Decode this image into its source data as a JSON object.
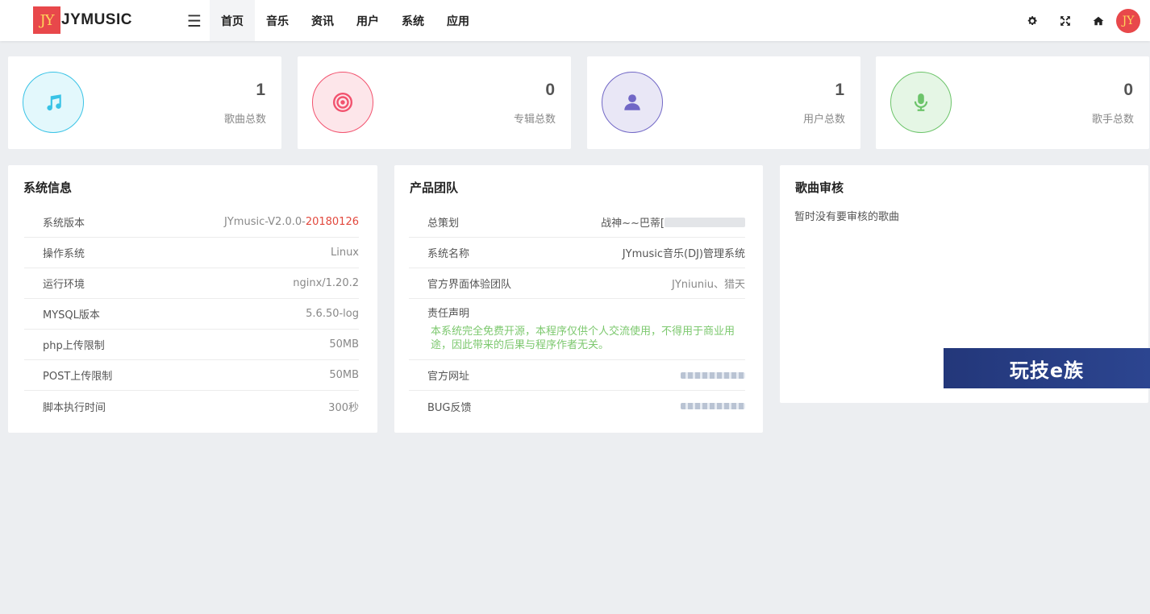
{
  "app": {
    "logo_badge": "JY",
    "name": "JYMUSIC"
  },
  "nav": {
    "menu_icon": "hamburger-icon",
    "items": [
      "首页",
      "音乐",
      "资讯",
      "用户",
      "系统",
      "应用"
    ],
    "active": "首页"
  },
  "tools": {
    "settings_icon": "gear-icon",
    "fullscreen_icon": "expand-icon",
    "home_icon": "home-icon",
    "avatar_text": "JY"
  },
  "stats": [
    {
      "value": "1",
      "label": "歌曲总数",
      "icon": "music-note-icon",
      "color": "#39c3e6"
    },
    {
      "value": "0",
      "label": "专辑总数",
      "icon": "target-icon",
      "color": "#f2526e"
    },
    {
      "value": "1",
      "label": "用户总数",
      "icon": "user-icon",
      "color": "#7167c6"
    },
    {
      "value": "0",
      "label": "歌手总数",
      "icon": "microphone-icon",
      "color": "#6cc46a"
    }
  ],
  "system_info": {
    "title": "系统信息",
    "rows": [
      {
        "key": "系统版本",
        "value_prefix": "JYmusic-V2.0.0-",
        "value_suffix": "20180126"
      },
      {
        "key": "操作系统",
        "value": "Linux"
      },
      {
        "key": "运行环境",
        "value": "nginx/1.20.2"
      },
      {
        "key": "MYSQL版本",
        "value": "5.6.50-log"
      },
      {
        "key": "php上传限制",
        "value": "50MB"
      },
      {
        "key": "POST上传限制",
        "value": "50MB"
      },
      {
        "key": "脚本执行时间",
        "value": "300秒"
      }
    ]
  },
  "team": {
    "title": "产品团队",
    "rows": [
      {
        "key": "总策划",
        "value": "战神~~巴蒂["
      },
      {
        "key": "系统名称",
        "value": "JYmusic音乐(DJ)管理系统"
      },
      {
        "key": "官方界面体验团队",
        "value": "JYniuniu、猎天"
      },
      {
        "key": "责任声明",
        "value": "本系统完全免费开源，本程序仅供个人交流使用，不得用于商业用途，因此带来的后果与程序作者无关。"
      },
      {
        "key": "官方网址"
      },
      {
        "key": "BUG反馈"
      }
    ]
  },
  "audit": {
    "title": "歌曲审核",
    "empty_text": "暂时没有要审核的歌曲"
  },
  "watermark": {
    "text": "玩技e族"
  }
}
